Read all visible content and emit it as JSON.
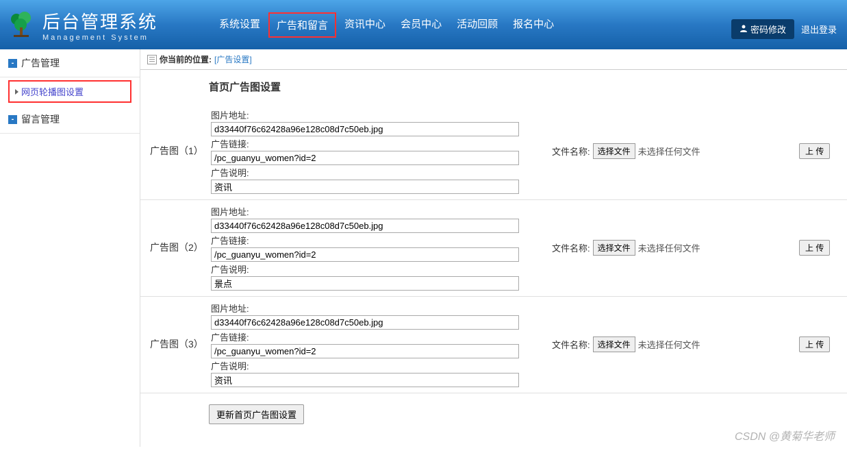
{
  "header": {
    "title_cn": "后台管理系统",
    "title_en": "Management System",
    "nav": [
      {
        "label": "系统设置"
      },
      {
        "label": "广告和留言",
        "highlight": true
      },
      {
        "label": "资讯中心"
      },
      {
        "label": "会员中心"
      },
      {
        "label": "活动回顾"
      },
      {
        "label": "报名中心"
      }
    ],
    "pwd_btn": "密码修改",
    "logout": "退出登录"
  },
  "sidebar": {
    "groups": [
      {
        "label": "广告管理",
        "items": [
          {
            "label": "网页轮播图设置",
            "active": true
          }
        ]
      },
      {
        "label": "留言管理"
      }
    ]
  },
  "breadcrumb": {
    "prefix": "你当前的位置:",
    "current": "[广告设置]"
  },
  "page_title": "首页广告图设置",
  "field_labels": {
    "image_url": "图片地址:",
    "link": "广告链接:",
    "desc": "广告说明:",
    "file_name": "文件名称:",
    "choose_file": "选择文件",
    "no_file": "未选择任何文件",
    "upload": "上 传"
  },
  "rows": [
    {
      "title": "广告图（1）",
      "image": "d33440f76c62428a96e128c08d7c50eb.jpg",
      "link": "/pc_guanyu_women?id=2",
      "desc": "资讯"
    },
    {
      "title": "广告图（2）",
      "image": "d33440f76c62428a96e128c08d7c50eb.jpg",
      "link": "/pc_guanyu_women?id=2",
      "desc": "景点"
    },
    {
      "title": "广告图（3）",
      "image": "d33440f76c62428a96e128c08d7c50eb.jpg",
      "link": "/pc_guanyu_women?id=2",
      "desc": "资讯"
    }
  ],
  "submit_label": "更新首页广告图设置",
  "watermark": "CSDN @黄菊华老师"
}
